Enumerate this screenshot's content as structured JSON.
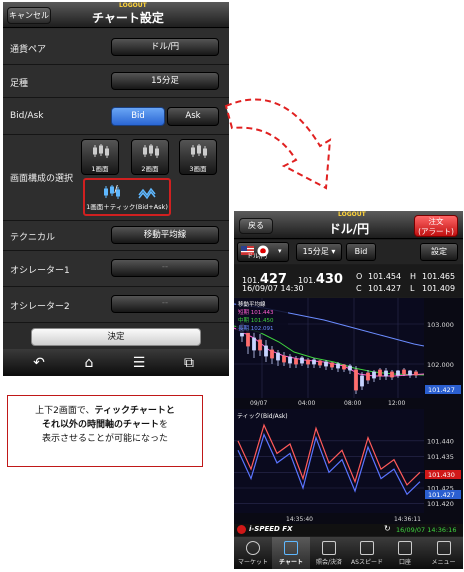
{
  "left": {
    "cancel": "キャンセル",
    "logout": "LOGOUT",
    "title": "チャート設定",
    "rows": [
      {
        "label": "通貨ペア",
        "value": "ドル/円"
      },
      {
        "label": "足種",
        "value": "15分足"
      },
      {
        "label": "Bid/Ask",
        "bid": "Bid",
        "ask": "Ask"
      },
      {
        "label": "画面構成の選択",
        "panes": [
          "1画面",
          "2画面",
          "3画面"
        ],
        "combo": "1画面＋ティック(Bid+Ask)",
        "combo_sep": "/"
      },
      {
        "label": "テクニカル",
        "value": "移動平均線"
      },
      {
        "label": "オシレーター1",
        "value": "--"
      },
      {
        "label": "オシレーター2",
        "value": "--"
      }
    ],
    "confirm": "決定"
  },
  "callout": {
    "line1a": "上下2画面で、",
    "line1b": "ティックチャートと",
    "line2a": "それ以外の時間軸のチャート",
    "line2b": "を",
    "line3": "表示させることが可能になった"
  },
  "right": {
    "back": "戻る",
    "logout": "LOGOUT",
    "title": "ドル/円",
    "order_line1": "注文",
    "order_line2": "(アラート)",
    "pair_label": "ドル/円",
    "interval": "15分足",
    "bidask": "Bid",
    "settings": "設定",
    "quote": {
      "bid_prefix": "101.",
      "bid_big": "427",
      "ask_prefix": "101.",
      "ask_big": "430",
      "date": "16/09/07  14:30",
      "o_label": "O",
      "o": "101.454",
      "h_label": "H",
      "h": "101.465",
      "c_label": "C",
      "c": "101.427",
      "l_label": "L",
      "l": "101.409"
    },
    "ma_legend": {
      "title": "移動平均線",
      "short": "短期 101.443",
      "mid": "中期 101.450",
      "long": "長期 102.091"
    },
    "upper_axis": [
      "103.000",
      "102.000"
    ],
    "upper_current": "101.427",
    "upper_x": [
      "09/07",
      "04:00",
      "08:00",
      "12:00"
    ],
    "tick_title": "ティック(Bid/Ask)",
    "lower_axis": [
      "101.440",
      "101.435",
      "101.430",
      "101.425",
      "101.420"
    ],
    "lower_current_ask": "101.430",
    "lower_current_bid": "101.427",
    "lower_x": [
      "14:35:40",
      "14:36:11"
    ],
    "footer_logo": "i-SPEED FX",
    "footer_time": "16/09/07 14:36:16",
    "nav": [
      "マーケット",
      "チャート",
      "照会/決済",
      "ASスピード",
      "口座",
      "メニュー"
    ]
  },
  "colors": {
    "accent": "#2f6fdc",
    "order": "#d01818",
    "callout_border": "#c01818"
  },
  "chart_data": {
    "type": "line",
    "series": [
      {
        "name": "Bid",
        "values": [
          101.437,
          101.428,
          101.442,
          101.433,
          101.436,
          101.425,
          101.441,
          101.43,
          101.434,
          101.424,
          101.438,
          101.428,
          101.431,
          101.423,
          101.427
        ]
      },
      {
        "name": "Ask",
        "values": [
          101.44,
          101.431,
          101.445,
          101.436,
          101.439,
          101.428,
          101.444,
          101.433,
          101.437,
          101.427,
          101.441,
          101.431,
          101.434,
          101.426,
          101.43
        ]
      }
    ],
    "ylim": [
      101.418,
      101.446
    ]
  }
}
